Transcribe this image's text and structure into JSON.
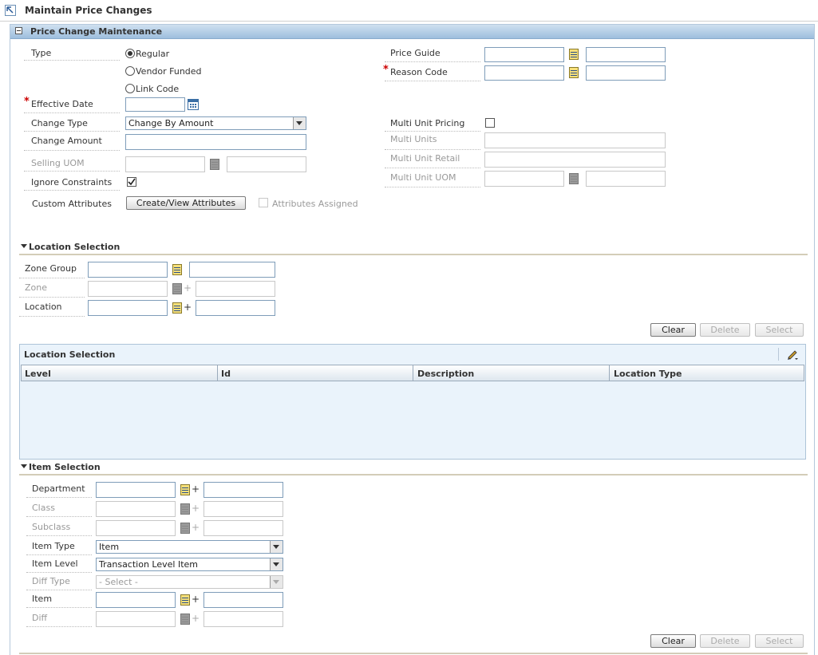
{
  "page": {
    "title": "Maintain Price Changes"
  },
  "panel": {
    "title": "Price Change Maintenance"
  },
  "form": {
    "type_label": "Type",
    "type_options": [
      "Regular",
      "Vendor Funded",
      "Link Code"
    ],
    "type_selected": "Regular",
    "effective_date_label": "Effective Date",
    "change_type_label": "Change Type",
    "change_type_value": "Change By Amount",
    "change_amount_label": "Change Amount",
    "selling_uom_label": "Selling UOM",
    "ignore_constraints_label": "Ignore Constraints",
    "ignore_constraints_checked": true,
    "custom_attributes_label": "Custom Attributes",
    "create_view_attributes_label": "Create/View Attributes",
    "attributes_assigned_label": "Attributes Assigned",
    "price_guide_label": "Price Guide",
    "reason_code_label": "Reason Code",
    "multi_unit_pricing_label": "Multi Unit Pricing",
    "multi_units_label": "Multi Units",
    "multi_unit_retail_label": "Multi Unit Retail",
    "multi_unit_uom_label": "Multi Unit UOM"
  },
  "location_selection": {
    "title": "Location Selection",
    "zone_group_label": "Zone Group",
    "zone_label": "Zone",
    "location_label": "Location",
    "clear_label": "Clear",
    "delete_label": "Delete",
    "select_label": "Select",
    "table_title": "Location Selection",
    "columns": [
      "Level",
      "Id",
      "Description",
      "Location Type"
    ]
  },
  "item_selection": {
    "title": "Item Selection",
    "department_label": "Department",
    "class_label": "Class",
    "subclass_label": "Subclass",
    "item_type_label": "Item Type",
    "item_type_value": "Item",
    "item_level_label": "Item Level",
    "item_level_value": "Transaction Level Item",
    "diff_type_label": "Diff Type",
    "diff_type_value": "- Select -",
    "item_label": "Item",
    "diff_label": "Diff",
    "clear_label": "Clear",
    "delete_label": "Delete",
    "select_label": "Select"
  },
  "colors": {
    "panel_header": "#9dbedd",
    "table_bg": "#eaf3fb",
    "required": "#cc0000"
  }
}
